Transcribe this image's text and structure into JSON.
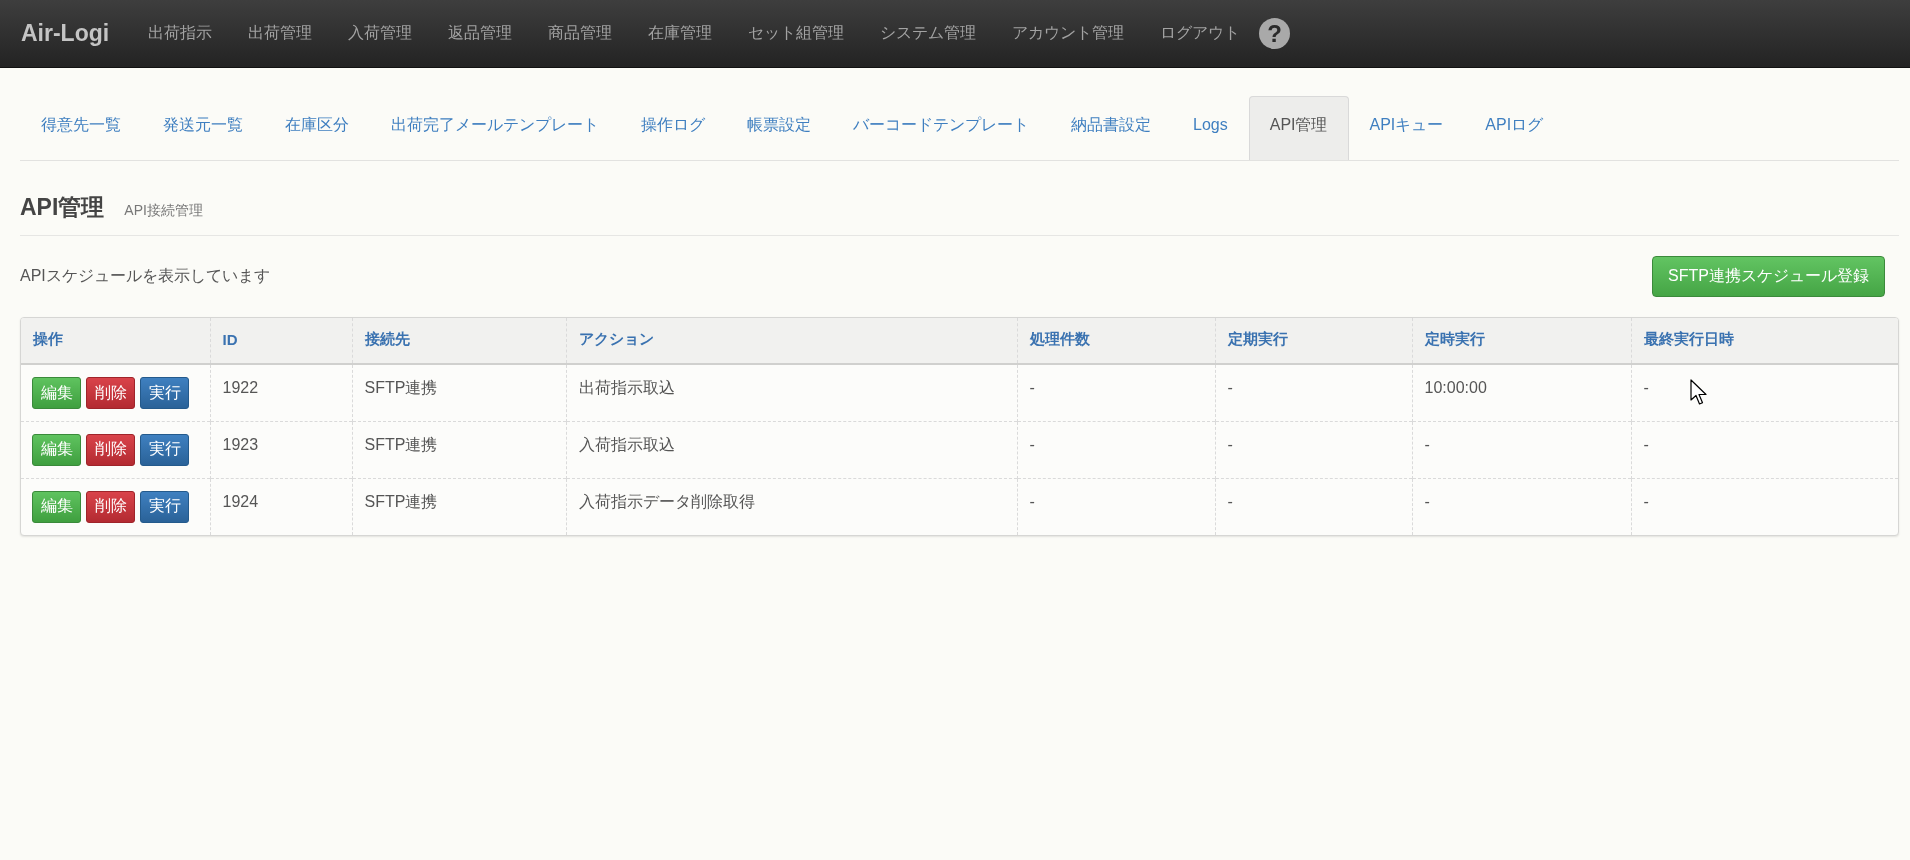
{
  "navbar": {
    "brand": "Air-Logi",
    "items": [
      "出荷指示",
      "出荷管理",
      "入荷管理",
      "返品管理",
      "商品管理",
      "在庫管理",
      "セット組管理",
      "システム管理",
      "アカウント管理",
      "ログアウト"
    ],
    "help": "?"
  },
  "tabs": [
    {
      "label": "得意先一覧",
      "selected": false
    },
    {
      "label": "発送元一覧",
      "selected": false
    },
    {
      "label": "在庫区分",
      "selected": false
    },
    {
      "label": "出荷完了メールテンプレート",
      "selected": false
    },
    {
      "label": "操作ログ",
      "selected": false
    },
    {
      "label": "帳票設定",
      "selected": false
    },
    {
      "label": "バーコードテンプレート",
      "selected": false
    },
    {
      "label": "納品書設定",
      "selected": false
    },
    {
      "label": "Logs",
      "selected": false
    },
    {
      "label": "API管理",
      "selected": true
    },
    {
      "label": "APIキュー",
      "selected": false
    },
    {
      "label": "APIログ",
      "selected": false
    }
  ],
  "page_header": {
    "title": "API管理",
    "subtitle": "API接続管理"
  },
  "info_text": "APIスケジュールを表示しています",
  "register_button": "SFTP連携スケジュール登録",
  "table": {
    "columns": [
      "操作",
      "ID",
      "接続先",
      "アクション",
      "処理件数",
      "定期実行",
      "定時実行",
      "最終実行日時"
    ],
    "rows": [
      {
        "cells": [
          {
            "buttons": [
              {
                "label": "編集",
                "kind": "edit"
              },
              {
                "label": "削除",
                "kind": "delete"
              },
              {
                "label": "実行",
                "kind": "run"
              }
            ]
          },
          "1922",
          "SFTP連携",
          "出荷指示取込",
          "-",
          "-",
          "10:00:00",
          "-"
        ]
      },
      {
        "cells": [
          {
            "buttons": [
              {
                "label": "編集",
                "kind": "edit"
              },
              {
                "label": "削除",
                "kind": "delete"
              },
              {
                "label": "実行",
                "kind": "run"
              }
            ]
          },
          "1923",
          "SFTP連携",
          "入荷指示取込",
          "-",
          "-",
          "-",
          "-"
        ]
      },
      {
        "cells": [
          {
            "buttons": [
              {
                "label": "編集",
                "kind": "edit"
              },
              {
                "label": "削除",
                "kind": "delete"
              },
              {
                "label": "実行",
                "kind": "run"
              }
            ]
          },
          "1924",
          "SFTP連携",
          "入荷指示データ削除取得",
          "-",
          "-",
          "-",
          "-"
        ]
      }
    ]
  }
}
